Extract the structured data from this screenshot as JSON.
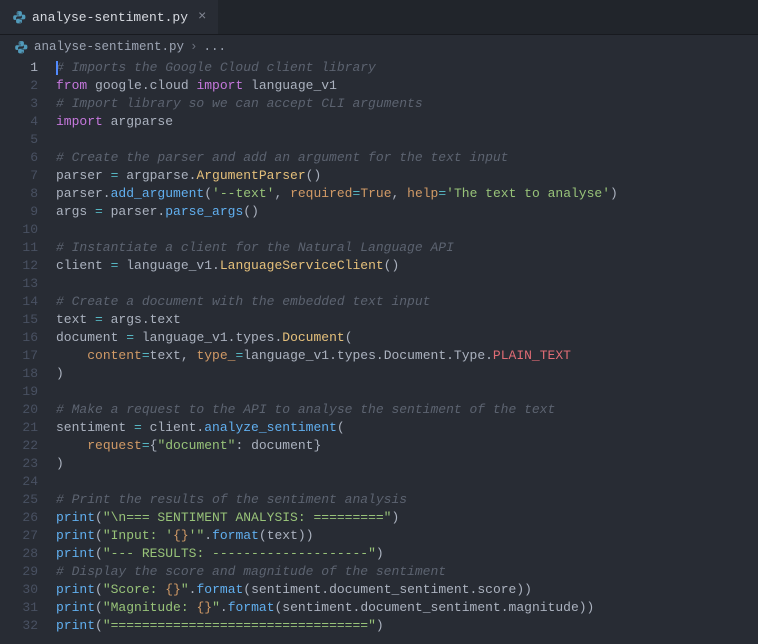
{
  "tab": {
    "filename": "analyse-sentiment.py",
    "close_glyph": "×"
  },
  "breadcrumb": {
    "filename": "analyse-sentiment.py",
    "sep1": "›",
    "ellipsis": "..."
  },
  "code": {
    "lines": [
      [
        {
          "c": "cm",
          "t": "# Imports the Google Cloud client library"
        }
      ],
      [
        {
          "c": "kw",
          "t": "from"
        },
        {
          "c": "pln",
          "t": " google.cloud "
        },
        {
          "c": "kw",
          "t": "import"
        },
        {
          "c": "pln",
          "t": " language_v1"
        }
      ],
      [
        {
          "c": "cm",
          "t": "# Import library so we can accept CLI arguments"
        }
      ],
      [
        {
          "c": "kw",
          "t": "import"
        },
        {
          "c": "pln",
          "t": " argparse"
        }
      ],
      [],
      [
        {
          "c": "cm",
          "t": "# Create the parser and add an argument for the text input"
        }
      ],
      [
        {
          "c": "pln",
          "t": "parser "
        },
        {
          "c": "op",
          "t": "="
        },
        {
          "c": "pln",
          "t": " argparse."
        },
        {
          "c": "cls",
          "t": "ArgumentParser"
        },
        {
          "c": "pln",
          "t": "()"
        }
      ],
      [
        {
          "c": "pln",
          "t": "parser."
        },
        {
          "c": "fn",
          "t": "add_argument"
        },
        {
          "c": "pln",
          "t": "("
        },
        {
          "c": "str",
          "t": "'--text'"
        },
        {
          "c": "pln",
          "t": ", "
        },
        {
          "c": "param",
          "t": "required"
        },
        {
          "c": "op",
          "t": "="
        },
        {
          "c": "const",
          "t": "True"
        },
        {
          "c": "pln",
          "t": ", "
        },
        {
          "c": "param",
          "t": "help"
        },
        {
          "c": "op",
          "t": "="
        },
        {
          "c": "str",
          "t": "'The text to analyse'"
        },
        {
          "c": "pln",
          "t": ")"
        }
      ],
      [
        {
          "c": "pln",
          "t": "args "
        },
        {
          "c": "op",
          "t": "="
        },
        {
          "c": "pln",
          "t": " parser."
        },
        {
          "c": "fn",
          "t": "parse_args"
        },
        {
          "c": "pln",
          "t": "()"
        }
      ],
      [],
      [
        {
          "c": "cm",
          "t": "# Instantiate a client for the Natural Language API"
        }
      ],
      [
        {
          "c": "pln",
          "t": "client "
        },
        {
          "c": "op",
          "t": "="
        },
        {
          "c": "pln",
          "t": " language_v1."
        },
        {
          "c": "cls",
          "t": "LanguageServiceClient"
        },
        {
          "c": "pln",
          "t": "()"
        }
      ],
      [],
      [
        {
          "c": "cm",
          "t": "# Create a document with the embedded text input"
        }
      ],
      [
        {
          "c": "pln",
          "t": "text "
        },
        {
          "c": "op",
          "t": "="
        },
        {
          "c": "pln",
          "t": " args.text"
        }
      ],
      [
        {
          "c": "pln",
          "t": "document "
        },
        {
          "c": "op",
          "t": "="
        },
        {
          "c": "pln",
          "t": " language_v1.types."
        },
        {
          "c": "cls",
          "t": "Document"
        },
        {
          "c": "pln",
          "t": "("
        }
      ],
      [
        {
          "c": "pln",
          "t": "    "
        },
        {
          "c": "param",
          "t": "content"
        },
        {
          "c": "op",
          "t": "="
        },
        {
          "c": "pln",
          "t": "text, "
        },
        {
          "c": "param",
          "t": "type_"
        },
        {
          "c": "op",
          "t": "="
        },
        {
          "c": "pln",
          "t": "language_v1.types.Document.Type."
        },
        {
          "c": "var",
          "t": "PLAIN_TEXT"
        }
      ],
      [
        {
          "c": "pln",
          "t": ")"
        }
      ],
      [],
      [
        {
          "c": "cm",
          "t": "# Make a request to the API to analyse the sentiment of the text"
        }
      ],
      [
        {
          "c": "pln",
          "t": "sentiment "
        },
        {
          "c": "op",
          "t": "="
        },
        {
          "c": "pln",
          "t": " client."
        },
        {
          "c": "fn",
          "t": "analyze_sentiment"
        },
        {
          "c": "pln",
          "t": "("
        }
      ],
      [
        {
          "c": "pln",
          "t": "    "
        },
        {
          "c": "param",
          "t": "request"
        },
        {
          "c": "op",
          "t": "="
        },
        {
          "c": "pln",
          "t": "{"
        },
        {
          "c": "str",
          "t": "\"document\""
        },
        {
          "c": "pln",
          "t": ": document}"
        }
      ],
      [
        {
          "c": "pln",
          "t": ")"
        }
      ],
      [],
      [
        {
          "c": "cm",
          "t": "# Print the results of the sentiment analysis"
        }
      ],
      [
        {
          "c": "fn",
          "t": "print"
        },
        {
          "c": "pln",
          "t": "("
        },
        {
          "c": "str",
          "t": "\"\\n=== SENTIMENT ANALYSIS: =========\""
        },
        {
          "c": "pln",
          "t": ")"
        }
      ],
      [
        {
          "c": "fn",
          "t": "print"
        },
        {
          "c": "pln",
          "t": "("
        },
        {
          "c": "str",
          "t": "\"Input: '"
        },
        {
          "c": "const",
          "t": "{}"
        },
        {
          "c": "str",
          "t": "'\""
        },
        {
          "c": "pln",
          "t": "."
        },
        {
          "c": "fn",
          "t": "format"
        },
        {
          "c": "pln",
          "t": "(text))"
        }
      ],
      [
        {
          "c": "fn",
          "t": "print"
        },
        {
          "c": "pln",
          "t": "("
        },
        {
          "c": "str",
          "t": "\"--- RESULTS: --------------------\""
        },
        {
          "c": "pln",
          "t": ")"
        }
      ],
      [
        {
          "c": "cm",
          "t": "# Display the score and magnitude of the sentiment"
        }
      ],
      [
        {
          "c": "fn",
          "t": "print"
        },
        {
          "c": "pln",
          "t": "("
        },
        {
          "c": "str",
          "t": "\"Score: "
        },
        {
          "c": "const",
          "t": "{}"
        },
        {
          "c": "str",
          "t": "\""
        },
        {
          "c": "pln",
          "t": "."
        },
        {
          "c": "fn",
          "t": "format"
        },
        {
          "c": "pln",
          "t": "(sentiment.document_sentiment.score))"
        }
      ],
      [
        {
          "c": "fn",
          "t": "print"
        },
        {
          "c": "pln",
          "t": "("
        },
        {
          "c": "str",
          "t": "\"Magnitude: "
        },
        {
          "c": "const",
          "t": "{}"
        },
        {
          "c": "str",
          "t": "\""
        },
        {
          "c": "pln",
          "t": "."
        },
        {
          "c": "fn",
          "t": "format"
        },
        {
          "c": "pln",
          "t": "(sentiment.document_sentiment.magnitude))"
        }
      ],
      [
        {
          "c": "fn",
          "t": "print"
        },
        {
          "c": "pln",
          "t": "("
        },
        {
          "c": "str",
          "t": "\"=================================\""
        },
        {
          "c": "pln",
          "t": ")"
        }
      ]
    ],
    "active_line": 1
  }
}
